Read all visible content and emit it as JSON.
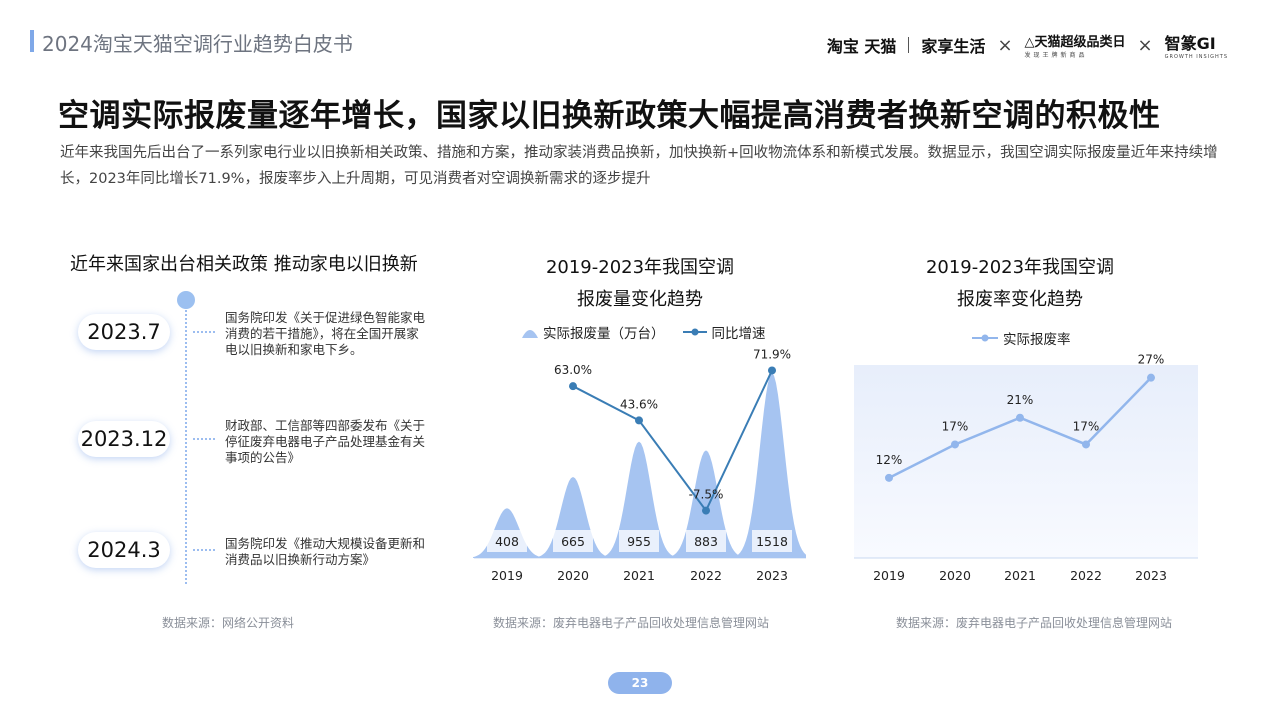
{
  "header": {
    "title": "2024淘宝天猫空调行业趋势白皮书",
    "brand_taobao_tmall": "淘宝 天猫",
    "brand_home": "家享生活",
    "brand_x": "×",
    "brand_super": "天猫超级品类日",
    "brand_super_sub": "发现王牌新商品",
    "brand_gi": "智篆GI",
    "brand_gi_sub": "GROWTH INSIGHTS"
  },
  "main": {
    "title": "空调实际报废量逐年增长，国家以旧换新政策大幅提高消费者换新空调的积极性",
    "description": "近年来我国先后出台了一系列家电行业以旧换新相关政策、措施和方案，推动家装消费品换新，加快换新+回收物流体系和新模式发展。数据显示，我国空调实际报废量近年来持续增长，2023年同比增长71.9%，报废率步入上升周期，可见消费者对空调换新需求的逐步提升"
  },
  "timeline": {
    "title": "近年来国家出台相关政策 推动家电以旧换新",
    "events": [
      {
        "date": "2023.7",
        "text": "国务院印发《关于促进绿色智能家电消费的若干措施》，将在全国开展家电以旧换新和家电下乡。"
      },
      {
        "date": "2023.12",
        "text": "财政部、工信部等四部委发布《关于停征废弃电器电子产品处理基金有关事项的公告》"
      },
      {
        "date": "2024.3",
        "text": "国务院印发《推动大规模设备更新和消费品以旧换新行动方案》"
      }
    ],
    "source": "数据来源：网络公开资料"
  },
  "chart1": {
    "title_line1": "2019-2023年我国空调",
    "title_line2": "报废量变化趋势",
    "legend_volume": "实际报废量（万台）",
    "legend_growth": "同比增速",
    "source": "数据来源：废弃电器电子产品回收处理信息管理网站"
  },
  "chart2": {
    "title_line1": "2019-2023年我国空调",
    "title_line2": "报废率变化趋势",
    "legend_rate": "实际报废率",
    "source": "数据来源：废弃电器电子产品回收处理信息管理网站"
  },
  "page_number": "23",
  "colors": {
    "accent": "#8fb3ec",
    "volume_fill": "#a6c4f1",
    "growth_line": "#3a7db5",
    "rate_line": "#92b6ec"
  },
  "chart_data": [
    {
      "type": "bar",
      "title": "2019-2023年我国空调报废量变化趋势",
      "categories": [
        "2019",
        "2020",
        "2021",
        "2022",
        "2023"
      ],
      "series": [
        {
          "name": "实际报废量（万台）",
          "type": "bar",
          "values": [
            408,
            665,
            955,
            883,
            1518
          ],
          "labels": [
            "408",
            "665",
            "955",
            "883",
            "1518"
          ]
        },
        {
          "name": "同比增速",
          "type": "line",
          "values": [
            null,
            63.0,
            43.6,
            -7.5,
            71.9
          ],
          "labels": [
            "",
            "63.0%",
            "43.6%",
            "-7.5%",
            "71.9%"
          ]
        }
      ]
    },
    {
      "type": "area",
      "title": "2019-2023年我国空调报废率变化趋势",
      "categories": [
        "2019",
        "2020",
        "2021",
        "2022",
        "2023"
      ],
      "series": [
        {
          "name": "实际报废率",
          "values": [
            12,
            17,
            21,
            17,
            27
          ],
          "labels": [
            "12%",
            "17%",
            "21%",
            "17%",
            "27%"
          ]
        }
      ]
    }
  ]
}
